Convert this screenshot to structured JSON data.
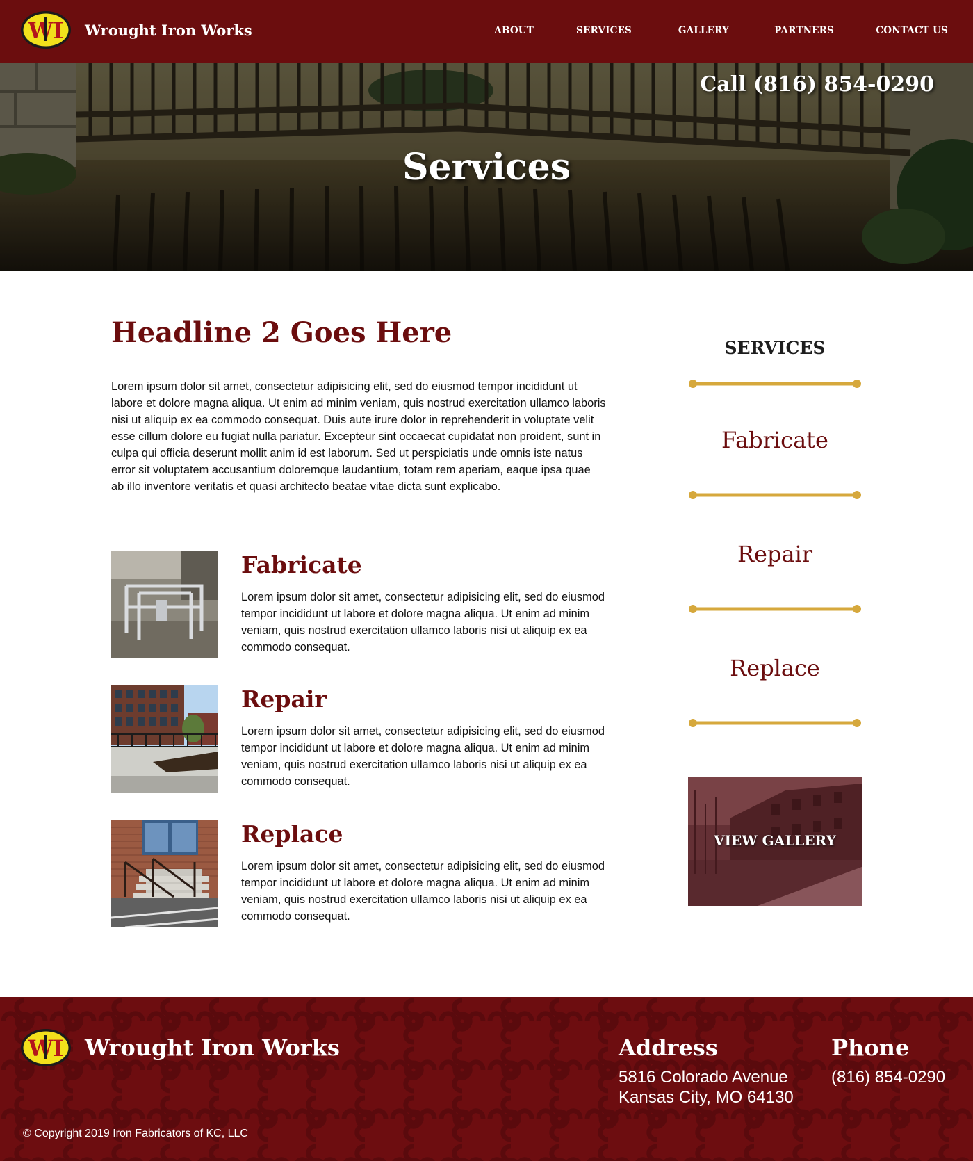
{
  "header": {
    "brand": "Wrought Iron Works",
    "logo_letters": "WI",
    "nav": [
      "ABOUT",
      "SERVICES",
      "GALLERY",
      "PARTNERS",
      "CONTACT US"
    ]
  },
  "hero": {
    "phone": "Call (816) 854-0290",
    "title": "Services"
  },
  "main": {
    "headline": "Headline 2 Goes Here",
    "intro": "Lorem ipsum dolor sit amet, consectetur adipisicing elit, sed do eiusmod tempor incididunt ut labore et dolore magna aliqua. Ut enim ad minim veniam, quis nostrud exercitation ullamco laboris nisi ut aliquip ex ea commodo consequat. Duis aute irure dolor in reprehenderit in voluptate velit esse cillum dolore eu fugiat nulla pariatur. Excepteur sint occaecat cupidatat non proident, sunt in culpa qui officia deserunt mollit anim id est laborum. Sed ut perspiciatis unde omnis iste natus error sit voluptatem accusantium doloremque laudantium, totam rem aperiam, eaque ipsa quae ab illo inventore veritatis et quasi architecto beatae vitae dicta sunt explicabo.",
    "services": [
      {
        "title": "Fabricate",
        "text": "Lorem ipsum dolor sit amet, consectetur adipisicing elit, sed do eiusmod tempor incididunt ut labore et dolore magna aliqua. Ut enim ad minim veniam, quis nostrud exercitation ullamco laboris nisi ut aliquip ex ea commodo consequat."
      },
      {
        "title": "Repair",
        "text": "Lorem ipsum dolor sit amet, consectetur adipisicing elit, sed do eiusmod tempor incididunt ut labore et dolore magna aliqua. Ut enim ad minim veniam, quis nostrud exercitation ullamco laboris nisi ut aliquip ex ea commodo consequat."
      },
      {
        "title": "Replace",
        "text": "Lorem ipsum dolor sit amet, consectetur adipisicing elit, sed do eiusmod tempor incididunt ut labore et dolore magna aliqua. Ut enim ad minim veniam, quis nostrud exercitation ullamco laboris nisi ut aliquip ex ea commodo consequat."
      }
    ]
  },
  "sidebar": {
    "heading": "SERVICES",
    "links": [
      "Fabricate",
      "Repair",
      "Replace"
    ],
    "gallery_label": "VIEW GALLERY"
  },
  "footer": {
    "brand": "Wrought Iron Works",
    "address_heading": "Address",
    "address_line1": "5816 Colorado Avenue",
    "address_line2": "Kansas City, MO 64130",
    "phone_heading": "Phone",
    "phone": "(816) 854-0290",
    "copyright": "© Copyright 2019 Iron Fabricators of KC, LLC"
  },
  "colors": {
    "brand_red": "#6b0d0e",
    "accent_gold": "#d6a83c",
    "logo_yellow": "#f2e11c"
  },
  "icons": [
    "logo-badge",
    "divider-rule"
  ]
}
